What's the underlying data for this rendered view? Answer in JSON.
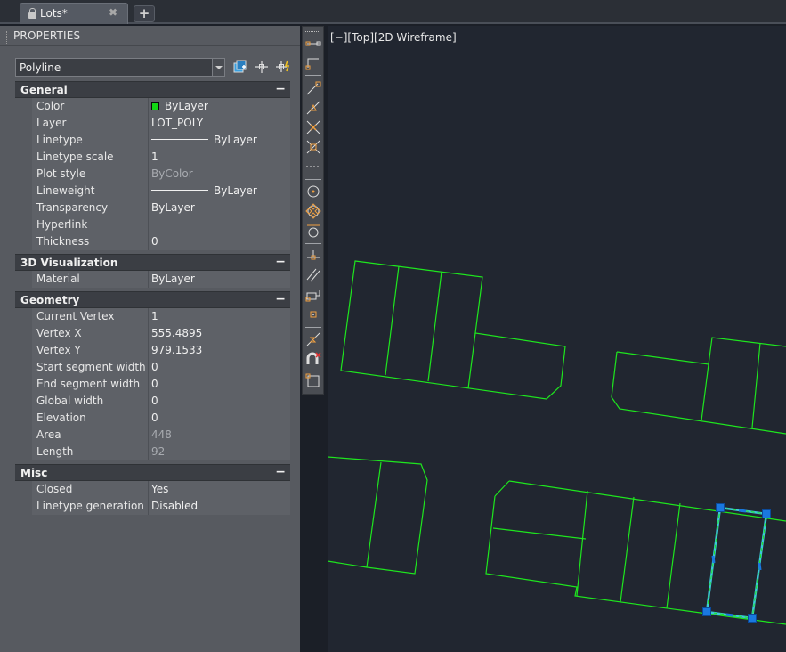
{
  "tabs": [
    {
      "label": "Lots*",
      "close": "✖"
    }
  ],
  "new_tab": "+",
  "palette": {
    "title": "PROPERTIES",
    "object_type": "Polyline",
    "sections": [
      {
        "title": "General",
        "collapse": "−",
        "rows": [
          {
            "name": "Color",
            "value": "ByLayer"
          },
          {
            "name": "Layer",
            "value": "LOT_POLY"
          },
          {
            "name": "Linetype",
            "value": "ByLayer"
          },
          {
            "name": "Linetype scale",
            "value": "1"
          },
          {
            "name": "Plot style",
            "value": "ByColor"
          },
          {
            "name": "Lineweight",
            "value": "ByLayer"
          },
          {
            "name": "Transparency",
            "value": "ByLayer"
          },
          {
            "name": "Hyperlink",
            "value": ""
          },
          {
            "name": "Thickness",
            "value": "0"
          }
        ]
      },
      {
        "title": "3D Visualization",
        "collapse": "−",
        "rows": [
          {
            "name": "Material",
            "value": "ByLayer"
          }
        ]
      },
      {
        "title": "Geometry",
        "collapse": "−",
        "rows": [
          {
            "name": "Current Vertex",
            "value": "1"
          },
          {
            "name": "Vertex X",
            "value": "555.4895"
          },
          {
            "name": "Vertex Y",
            "value": "979.1533"
          },
          {
            "name": "Start segment width",
            "value": "0"
          },
          {
            "name": "End segment width",
            "value": "0"
          },
          {
            "name": "Global width",
            "value": "0"
          },
          {
            "name": "Elevation",
            "value": "0"
          },
          {
            "name": "Area",
            "value": "448"
          },
          {
            "name": "Length",
            "value": "92"
          }
        ]
      },
      {
        "title": "Misc",
        "collapse": "−",
        "rows": [
          {
            "name": "Closed",
            "value": "Yes"
          },
          {
            "name": "Linetype generation",
            "value": "Disabled"
          }
        ]
      }
    ]
  },
  "viewport": {
    "label": "[−][Top][2D Wireframe]"
  },
  "colors": {
    "lot_lines": "#1ee61e",
    "layer_color": "#12d814",
    "selection_grip": "#1a78e0",
    "background": "#212630"
  }
}
